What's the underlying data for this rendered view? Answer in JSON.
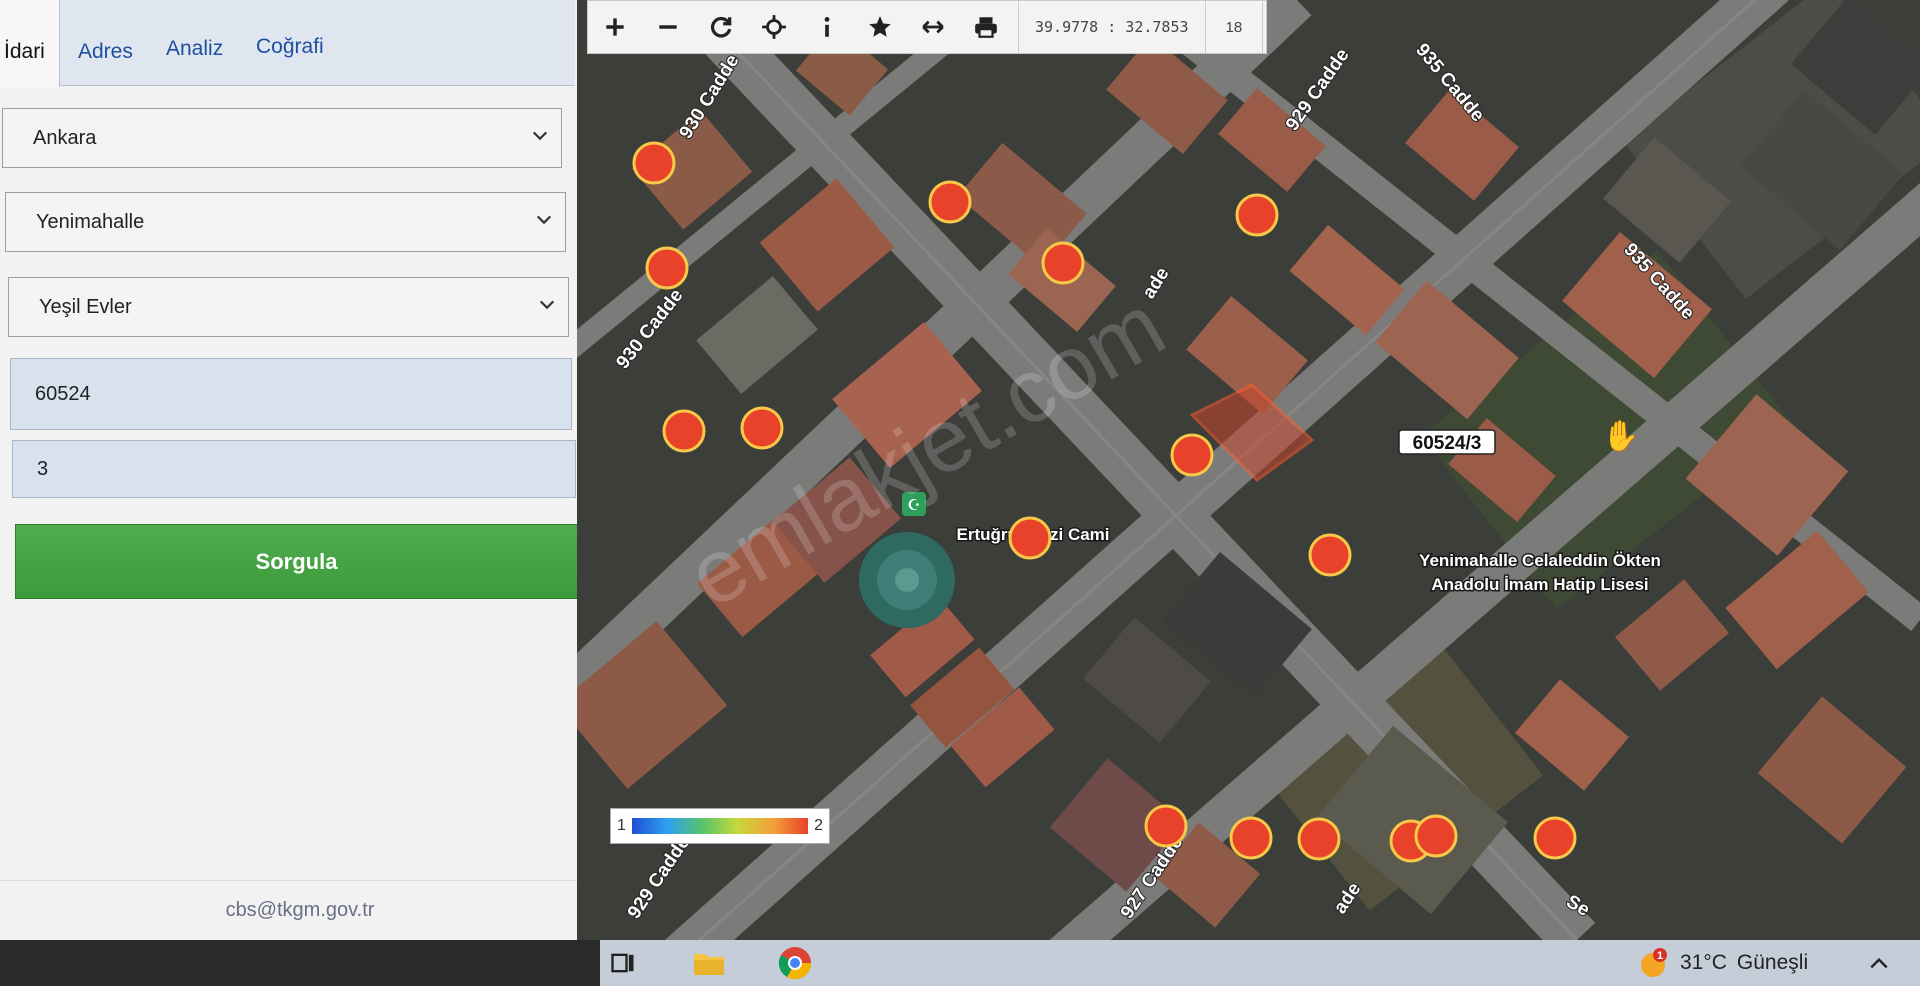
{
  "tabs": [
    {
      "label": "İdari",
      "active": true
    },
    {
      "label": "Adres"
    },
    {
      "label": "Analiz"
    },
    {
      "label": "Coğrafi"
    }
  ],
  "form": {
    "province": "Ankara",
    "district": "Yenimahalle",
    "neighborhood": "Yeşil Evler",
    "block": "60524",
    "parcel": "3",
    "query_label": "Sorgula",
    "query_color": "#43a541"
  },
  "footer": {
    "email": "cbs@tkgm.gov.tr"
  },
  "toolbar": {
    "icons": [
      "zoom-in-icon",
      "zoom-out-icon",
      "refresh-icon",
      "locate-icon",
      "info-icon",
      "favorite-icon",
      "measure-icon",
      "print-icon"
    ],
    "coordinates": "39.9778 : 32.7853",
    "zoom_level": "18"
  },
  "map": {
    "streets": [
      {
        "label": "930 Cadde"
      },
      {
        "label": "930 Cadde"
      },
      {
        "label": "929 Cadde"
      },
      {
        "label": "935 Cadde"
      },
      {
        "label": "935 Cadde"
      },
      {
        "label": "ade"
      },
      {
        "label": "929 Cadde"
      },
      {
        "label": "927 Cadde"
      },
      {
        "label": "ade"
      },
      {
        "label": "Se"
      }
    ],
    "parcel_label": "60524/3",
    "poi_mosque": "Ertuğrul Gazi Cami",
    "poi_school_line1": "Yenimahalle Celaleddin Ökten",
    "poi_school_line2": "Anadolu İmam Hatip Lisesi",
    "watermark": "emlakjet.com",
    "marker_color": "#e8432a"
  },
  "legend": {
    "min": "1",
    "max": "2"
  },
  "taskbar": {
    "temperature": "31°C",
    "weather": "Güneşli",
    "weather_badge": "1",
    "icons": [
      "task-view-icon",
      "file-explorer-icon",
      "chrome-icon"
    ]
  }
}
